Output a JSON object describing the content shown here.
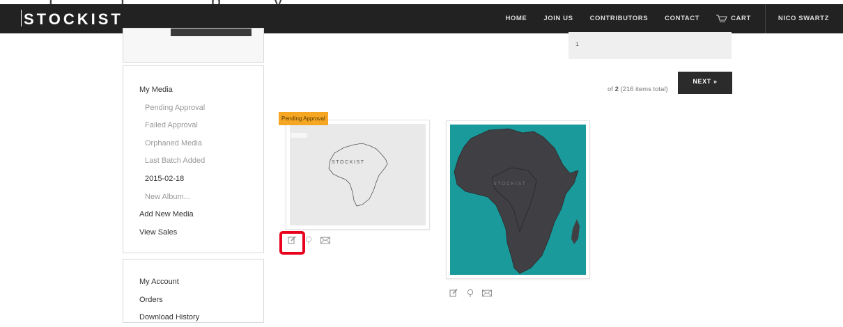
{
  "header": {
    "logo": "STOCKIST",
    "nav": [
      "HOME",
      "JOIN US",
      "CONTRIBUTORS",
      "CONTACT"
    ],
    "cart_label": "CART",
    "user": "NICO SWARTZ"
  },
  "sidebar": {
    "media_menu": [
      {
        "label": "My Media",
        "kind": "main"
      },
      {
        "label": "Pending Approval",
        "kind": "sub"
      },
      {
        "label": "Failed Approval",
        "kind": "sub"
      },
      {
        "label": "Orphaned Media",
        "kind": "sub"
      },
      {
        "label": "Last Batch Added",
        "kind": "sub"
      },
      {
        "label": "2015-02-18",
        "kind": "active"
      },
      {
        "label": "New Album...",
        "kind": "sub"
      },
      {
        "label": "Add New Media",
        "kind": "main"
      },
      {
        "label": "View Sales",
        "kind": "main"
      }
    ],
    "account_menu": [
      {
        "label": "My Account"
      },
      {
        "label": "Orders"
      },
      {
        "label": "Download History"
      }
    ]
  },
  "pagination": {
    "page_value": "1",
    "of_prefix": "of ",
    "total_pages": "2",
    "items_text": " (216 items total)",
    "next_label": "NEXT »"
  },
  "media": {
    "pending_tag": "Pending Approval",
    "watermark": "STOCKIST"
  },
  "colors": {
    "header_bg": "#222222",
    "pending_tag": "#f5a623",
    "thumb_teal": "#1a9a9a",
    "highlight": "#e8001c"
  }
}
